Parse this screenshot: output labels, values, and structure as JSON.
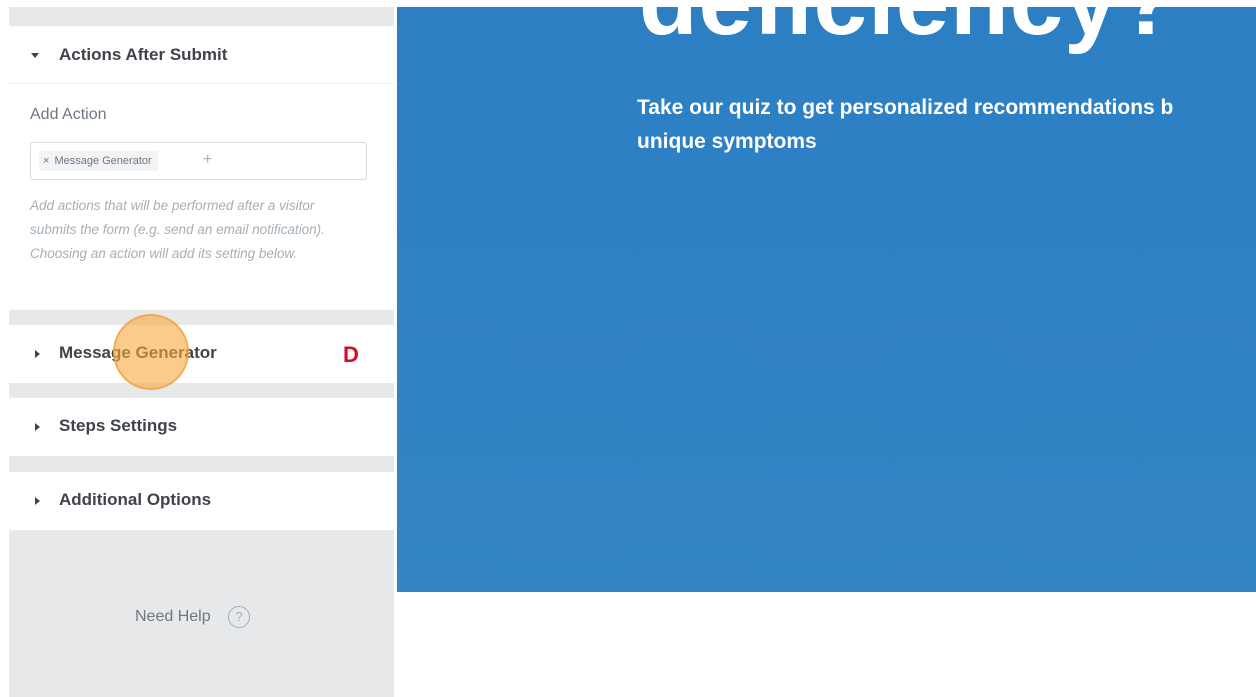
{
  "sidebar": {
    "actions_section": {
      "title": "Actions After Submit",
      "add_action_label": "Add Action",
      "selected_tag": "Message Generator",
      "tag_remove_icon": "×",
      "add_tag_icon": "+",
      "help_text": "Add actions that will be performed after a visitor submits the form (e.g. send an email notification). Choosing an action will add its setting below."
    },
    "sections": [
      {
        "title": "Message Generator",
        "badge": "D"
      },
      {
        "title": "Steps Settings"
      },
      {
        "title": "Additional Options"
      }
    ],
    "need_help": "Need Help",
    "help_icon": "?"
  },
  "collapse_tab": {
    "icon": "‹"
  },
  "preview": {
    "heading_fragment": "deficiency?",
    "subtitle": "Take our quiz to get personalized recommendations b\nunique symptoms",
    "colors": {
      "hero_bg": "#2c7fc3",
      "panel_bg": "#e6e8ea",
      "accent": "#d30c24"
    }
  }
}
